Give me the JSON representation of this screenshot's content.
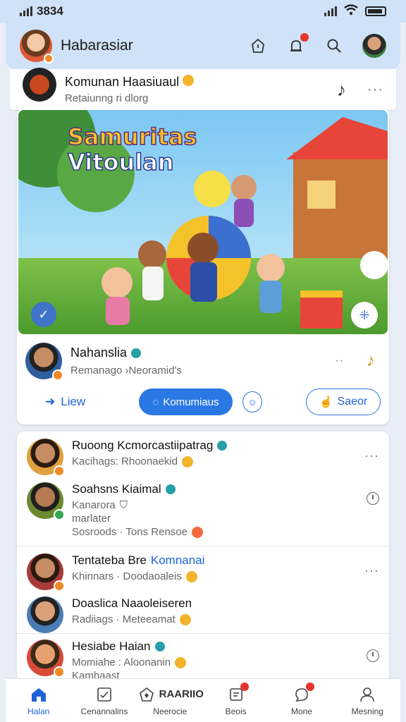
{
  "status_bar": {
    "time": "3834"
  },
  "header": {
    "title": "Habarasiar"
  },
  "community": {
    "title": "Komunan Haasiuaul",
    "subtitle": "Retaiunng ri dlorg"
  },
  "banner": {
    "line1": "Samuritas",
    "line2": "Vitoulan"
  },
  "post_author": {
    "name": "Nahanslia",
    "meta": "Remanago ›Neoramid's"
  },
  "actions": {
    "view": "Liew",
    "primary": "Komumiaus",
    "outline": "Saeor"
  },
  "list": [
    {
      "name": "Ruoong Kcmorcastiipatrag",
      "lines": [
        "Kacihags: Rhoonaekid"
      ],
      "right": "dots"
    },
    {
      "name": "Soahsns Kiaimal",
      "lines": [
        "Kanarora",
        "marlater",
        "Sosroods · Tons Rensoe"
      ],
      "right": "clock"
    },
    {
      "name": "Tentateba Bre",
      "name_highlight": "Komnanai",
      "lines": [
        "Khinnars · Doodaoaleis"
      ],
      "right": "dots"
    },
    {
      "name": "Doaslica Naaoleiseren",
      "lines": [
        "Radiiags · Meteeamat"
      ],
      "right": ""
    },
    {
      "name": "Hesiabe Haian",
      "lines": [
        "Momiahe : Aloonanin",
        "Kamhaast"
      ],
      "right": "clock"
    }
  ],
  "bottom_nav": [
    {
      "label": "Halan",
      "icon": "home-icon",
      "active": true
    },
    {
      "label": "Cenannalins",
      "icon": "checklist-icon"
    },
    {
      "label": "Neerocie",
      "icon": "pentagon-icon",
      "inline": "RAARIIO"
    },
    {
      "label": "Beois",
      "icon": "document-icon",
      "badge": true
    },
    {
      "label": "Mone",
      "icon": "chat-icon",
      "badge": true
    },
    {
      "label": "Mesning",
      "icon": "profile-icon"
    }
  ],
  "colors": {
    "accent": "#2a78e4",
    "header_bg": "#cfe2f7",
    "badge": "#e5342b"
  }
}
